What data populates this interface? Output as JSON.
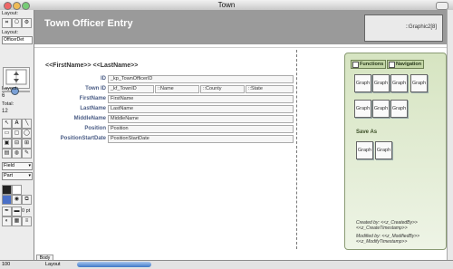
{
  "window": {
    "title": "Town"
  },
  "status_area": {
    "layout_label": "Layout:",
    "layout_value": "OfficerDet",
    "layout_count_label": "Layout:",
    "layout_count": "6",
    "total_label": "Total:",
    "total": "12",
    "field_select": "Field",
    "part_select": "Part",
    "line_width": "0 pt"
  },
  "header": {
    "title": "Town Officer Entry",
    "graphic": "::Graphic2[8]"
  },
  "name_line": "<<FirstName>> <<LastName>>",
  "fields": {
    "id": {
      "label": "ID",
      "value": "_kp_TownOfficerID"
    },
    "town_id": {
      "label": "Town ID",
      "value": "_kf_TownID"
    },
    "town_name": {
      "value": "::Name"
    },
    "town_county": {
      "value": "::County"
    },
    "town_state": {
      "value": "::State"
    },
    "firstname": {
      "label": "FirstName",
      "value": "FirstName"
    },
    "lastname": {
      "label": "LastName",
      "value": "LastName"
    },
    "middlename": {
      "label": "MiddleName",
      "value": "MiddleName"
    },
    "position": {
      "label": "Position",
      "value": "Position"
    },
    "position_start": {
      "label": "PositionStartDate",
      "value": "PositionStartDate"
    }
  },
  "panel": {
    "tab_functions": "Functions",
    "tab_navigation": "Navigation",
    "graph_label": "Graph",
    "save_as": "Save As",
    "created_by": "Created by: <<z_CreatedBy>>",
    "created_ts": "<<z_CreateTimestamp>>",
    "modified_by": "Modified by: <<z_ModifiedBy>>",
    "modified_ts": "<<z_ModifyTimestamp>>"
  },
  "bottom": {
    "zoom": "100",
    "part_tag": "Body",
    "mode": "Layout"
  }
}
